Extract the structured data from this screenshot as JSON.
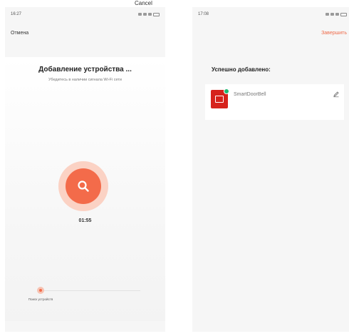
{
  "caption": {
    "text": "Cancel"
  },
  "left_screen": {
    "status_time": "16:27",
    "cancel_label": "Отмена",
    "title": "Добавление устройства ...",
    "subtitle": "Убедитесь в наличии сигнала Wi-Fi сети",
    "timer": "01:55",
    "steps": [
      {
        "label": "Поиск устройств",
        "state": "active"
      },
      {
        "label": "",
        "state": "pending"
      },
      {
        "label": "",
        "state": "pending"
      }
    ]
  },
  "right_screen": {
    "status_time": "17:08",
    "done_label": "Завершить",
    "success_title": "Успешно добавлено:",
    "device": {
      "name": "SmartDoorBell",
      "room": ""
    }
  },
  "icons": {
    "search": "search-icon",
    "edit": "pencil-icon",
    "device": "doorbell-device-icon",
    "online": "online-badge-icon"
  },
  "colors": {
    "accent": "#f36b4a",
    "accent_light": "#fbd2c4",
    "device_red": "#d6231c",
    "online_green": "#1fb873"
  }
}
